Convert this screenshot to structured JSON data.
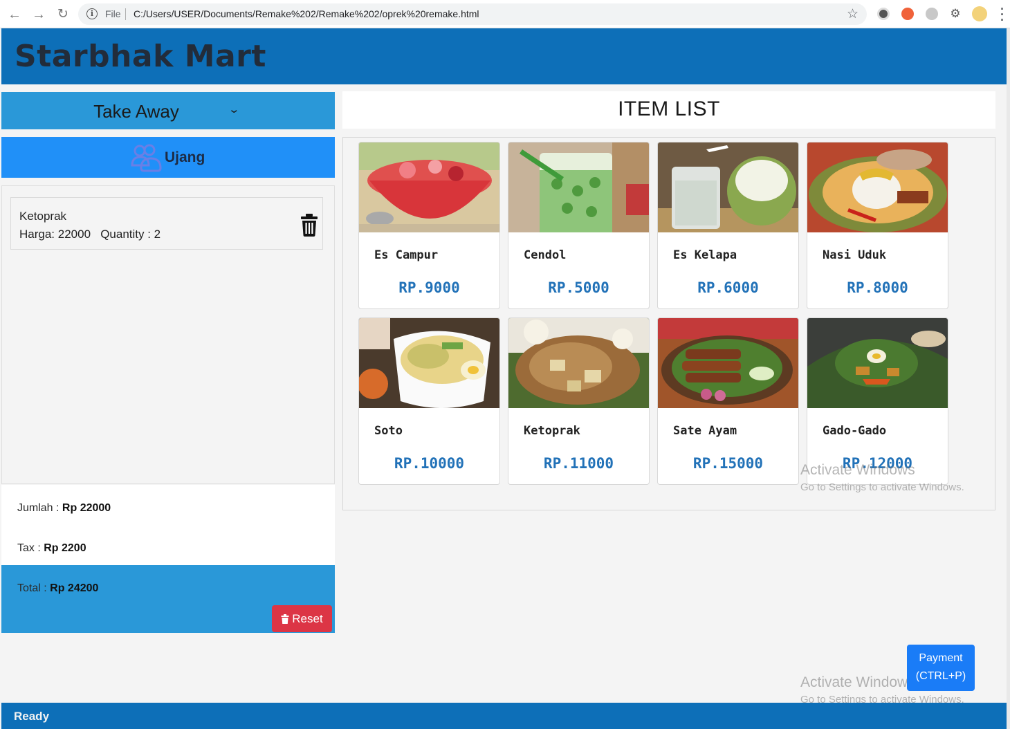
{
  "browser": {
    "file_label": "File",
    "url": "C:/Users/USER/Documents/Remake%202/Remake%202/oprek%20remake.html"
  },
  "app": {
    "title": "Starbhak Mart",
    "status": "Ready"
  },
  "order": {
    "type": "Take Away",
    "customer": "Ujang"
  },
  "cart": [
    {
      "name": "Ketoprak",
      "detail": "Harga: 22000   Quantity : 2"
    }
  ],
  "summary": {
    "jumlah_label": "Jumlah : ",
    "jumlah_value": "Rp 22000",
    "tax_label": "Tax : ",
    "tax_value": "Rp 2200",
    "total_label": "Total : ",
    "total_value": "Rp 24200",
    "reset_label": "Reset"
  },
  "item_list": {
    "title": "ITEM LIST",
    "items": [
      {
        "name": "Es Campur",
        "price": "RP.9000"
      },
      {
        "name": "Cendol",
        "price": "RP.5000"
      },
      {
        "name": "Es Kelapa",
        "price": "RP.6000"
      },
      {
        "name": "Nasi Uduk",
        "price": "RP.8000"
      },
      {
        "name": "Soto",
        "price": "RP.10000"
      },
      {
        "name": "Ketoprak",
        "price": "RP.11000"
      },
      {
        "name": "Sate Ayam",
        "price": "RP.15000"
      },
      {
        "name": "Gado-Gado",
        "price": "RP.12000"
      }
    ]
  },
  "payment": {
    "line1": "Payment",
    "line2": "(CTRL+P)"
  },
  "watermark": {
    "title": "Activate Windows",
    "subtitle": "Go to Settings to activate Windows."
  },
  "colors": {
    "header": "#0d6fb8",
    "order_type": "#2a98d8",
    "customer": "#2090f8",
    "reset": "#dc3545",
    "payment": "#1a7cf7",
    "price": "#2272b8"
  }
}
